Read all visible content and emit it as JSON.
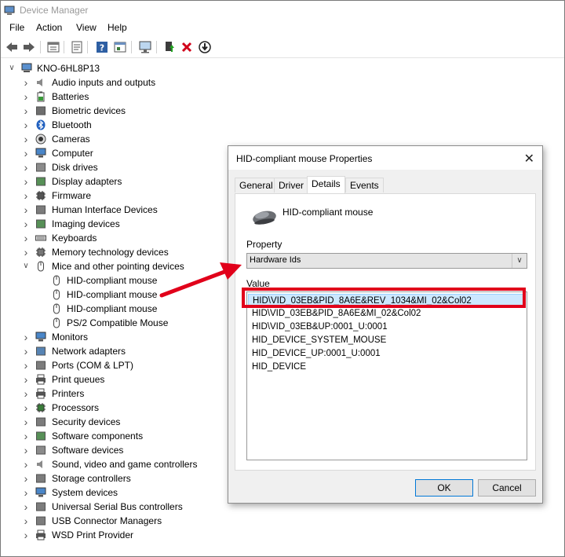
{
  "window": {
    "title": "Device Manager"
  },
  "menu": [
    "File",
    "Action",
    "View",
    "Help"
  ],
  "tree": {
    "root": "KNO-6HL8P13",
    "categories": [
      {
        "label": "Audio inputs and outputs",
        "icon": "speaker-icon"
      },
      {
        "label": "Batteries",
        "icon": "battery-icon"
      },
      {
        "label": "Biometric devices",
        "icon": "fingerprint-icon"
      },
      {
        "label": "Bluetooth",
        "icon": "bluetooth-icon"
      },
      {
        "label": "Cameras",
        "icon": "camera-icon"
      },
      {
        "label": "Computer",
        "icon": "computer-icon"
      },
      {
        "label": "Disk drives",
        "icon": "disk-drive-icon"
      },
      {
        "label": "Display adapters",
        "icon": "display-adapter-icon"
      },
      {
        "label": "Firmware",
        "icon": "chip-icon"
      },
      {
        "label": "Human Interface Devices",
        "icon": "hid-icon"
      },
      {
        "label": "Imaging devices",
        "icon": "scanner-icon"
      },
      {
        "label": "Keyboards",
        "icon": "keyboard-icon"
      },
      {
        "label": "Memory technology devices",
        "icon": "memory-icon"
      },
      {
        "label": "Mice and other pointing devices",
        "icon": "mouse-icon",
        "expanded": true,
        "children": [
          "HID-compliant mouse",
          "HID-compliant mouse",
          "HID-compliant mouse",
          "PS/2 Compatible Mouse"
        ]
      },
      {
        "label": "Monitors",
        "icon": "monitor-icon"
      },
      {
        "label": "Network adapters",
        "icon": "network-icon"
      },
      {
        "label": "Ports (COM & LPT)",
        "icon": "port-icon"
      },
      {
        "label": "Print queues",
        "icon": "printer-icon"
      },
      {
        "label": "Printers",
        "icon": "printer-icon"
      },
      {
        "label": "Processors",
        "icon": "processor-icon"
      },
      {
        "label": "Security devices",
        "icon": "security-icon"
      },
      {
        "label": "Software components",
        "icon": "component-icon"
      },
      {
        "label": "Software devices",
        "icon": "software-device-icon"
      },
      {
        "label": "Sound, video and game controllers",
        "icon": "speaker-icon"
      },
      {
        "label": "Storage controllers",
        "icon": "storage-icon"
      },
      {
        "label": "System devices",
        "icon": "system-icon"
      },
      {
        "label": "Universal Serial Bus controllers",
        "icon": "usb-icon"
      },
      {
        "label": "USB Connector Managers",
        "icon": "usb-icon"
      },
      {
        "label": "WSD Print Provider",
        "icon": "printer-icon"
      }
    ]
  },
  "dialog": {
    "title": "HID-compliant mouse Properties",
    "tabs": [
      "General",
      "Driver",
      "Details",
      "Events"
    ],
    "active_tab": "Details",
    "device_name": "HID-compliant mouse",
    "property_label": "Property",
    "property_value": "Hardware Ids",
    "value_label": "Value",
    "values": [
      "HID\\VID_03EB&PID_8A6E&REV_1034&MI_02&Col02",
      "HID\\VID_03EB&PID_8A6E&MI_02&Col02",
      "HID\\VID_03EB&UP:0001_U:0001",
      "HID_DEVICE_SYSTEM_MOUSE",
      "HID_DEVICE_UP:0001_U:0001",
      "HID_DEVICE"
    ],
    "ok_label": "OK",
    "cancel_label": "Cancel"
  },
  "colors": {
    "annotation": "#e1001a",
    "selection": "#cce8ff"
  }
}
